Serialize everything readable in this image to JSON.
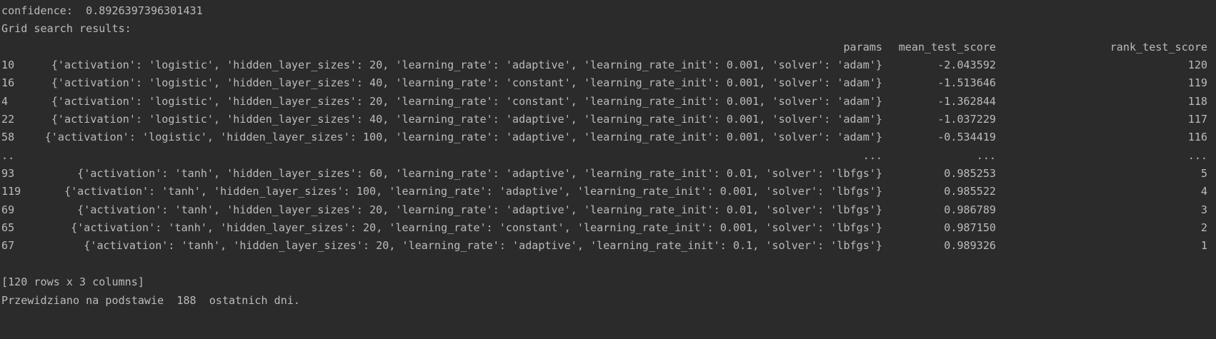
{
  "console": {
    "confidence_line": "confidence:  0.8926397396301431",
    "grid_title": "Grid search results:",
    "table": {
      "headers": {
        "params": "params",
        "mean_test_score": "mean_test_score",
        "rank_test_score": "rank_test_score"
      },
      "rows": [
        {
          "index": "10",
          "params": "{'activation': 'logistic', 'hidden_layer_sizes': 20, 'learning_rate': 'adaptive', 'learning_rate_init': 0.001, 'solver': 'adam'}",
          "mean": "-2.043592",
          "rank": "120"
        },
        {
          "index": "16",
          "params": "{'activation': 'logistic', 'hidden_layer_sizes': 40, 'learning_rate': 'constant', 'learning_rate_init': 0.001, 'solver': 'adam'}",
          "mean": "-1.513646",
          "rank": "119"
        },
        {
          "index": "4",
          "params": "{'activation': 'logistic', 'hidden_layer_sizes': 20, 'learning_rate': 'constant', 'learning_rate_init': 0.001, 'solver': 'adam'}",
          "mean": "-1.362844",
          "rank": "118"
        },
        {
          "index": "22",
          "params": "{'activation': 'logistic', 'hidden_layer_sizes': 40, 'learning_rate': 'adaptive', 'learning_rate_init': 0.001, 'solver': 'adam'}",
          "mean": "-1.037229",
          "rank": "117"
        },
        {
          "index": "58",
          "params": "{'activation': 'logistic', 'hidden_layer_sizes': 100, 'learning_rate': 'adaptive', 'learning_rate_init': 0.001, 'solver': 'adam'}",
          "mean": "-0.534419",
          "rank": "116"
        },
        {
          "index": "..",
          "params": "...",
          "mean": "...",
          "rank": "..."
        },
        {
          "index": "93",
          "params": "{'activation': 'tanh', 'hidden_layer_sizes': 60, 'learning_rate': 'adaptive', 'learning_rate_init': 0.01, 'solver': 'lbfgs'}",
          "mean": "0.985253",
          "rank": "5"
        },
        {
          "index": "119",
          "params": "{'activation': 'tanh', 'hidden_layer_sizes': 100, 'learning_rate': 'adaptive', 'learning_rate_init': 0.001, 'solver': 'lbfgs'}",
          "mean": "0.985522",
          "rank": "4"
        },
        {
          "index": "69",
          "params": "{'activation': 'tanh', 'hidden_layer_sizes': 20, 'learning_rate': 'adaptive', 'learning_rate_init': 0.01, 'solver': 'lbfgs'}",
          "mean": "0.986789",
          "rank": "3"
        },
        {
          "index": "65",
          "params": "{'activation': 'tanh', 'hidden_layer_sizes': 20, 'learning_rate': 'constant', 'learning_rate_init': 0.001, 'solver': 'lbfgs'}",
          "mean": "0.987150",
          "rank": "2"
        },
        {
          "index": "67",
          "params": "{'activation': 'tanh', 'hidden_layer_sizes': 20, 'learning_rate': 'adaptive', 'learning_rate_init': 0.1, 'solver': 'lbfgs'}",
          "mean": "0.989326",
          "rank": "1"
        }
      ],
      "shape_line": "[120 rows x 3 columns]"
    },
    "prediction_line": "Przewidziano na podstawie  188  ostatnich dni.",
    "colors": {
      "background": "#2b2b2b",
      "text": "#bbbbbb"
    }
  }
}
